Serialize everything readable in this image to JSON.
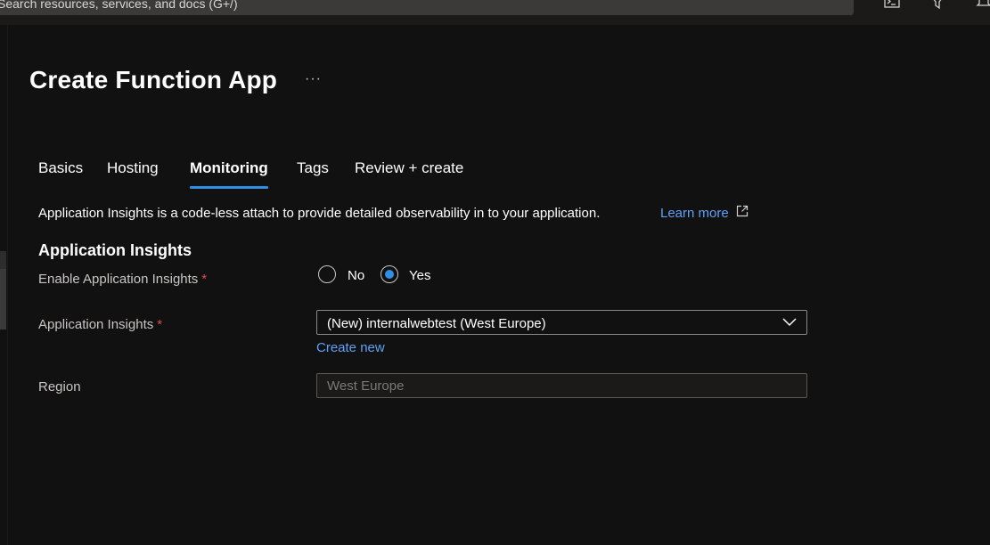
{
  "topbar": {
    "search_placeholder": "Search resources, services, and docs (G+/)",
    "icons": [
      "cloud-shell-icon",
      "directory-filter-icon",
      "notifications-icon"
    ]
  },
  "page": {
    "title": "Create Function App",
    "more": "···"
  },
  "tabs": [
    {
      "label": "Basics",
      "active": false
    },
    {
      "label": "Hosting",
      "active": false
    },
    {
      "label": "Monitoring",
      "active": true
    },
    {
      "label": "Tags",
      "active": false
    },
    {
      "label": "Review + create",
      "active": false
    }
  ],
  "description": {
    "text": "Application Insights is a code-less attach to provide detailed observability in to your application.",
    "learn_more": "Learn more"
  },
  "section": {
    "title": "Application Insights"
  },
  "enable_field": {
    "label": "Enable Application Insights",
    "required": "*",
    "options": [
      "No",
      "Yes"
    ],
    "selected": "Yes"
  },
  "insights_field": {
    "label": "Application Insights",
    "required": "*",
    "value": "(New) internalwebtest (West Europe)",
    "create_new": "Create new"
  },
  "region_field": {
    "label": "Region",
    "value": "West Europe"
  },
  "colors": {
    "background": "#111112",
    "accent": "#2f8fe6",
    "link": "#5ea1f5",
    "required": "#e04a4a"
  }
}
